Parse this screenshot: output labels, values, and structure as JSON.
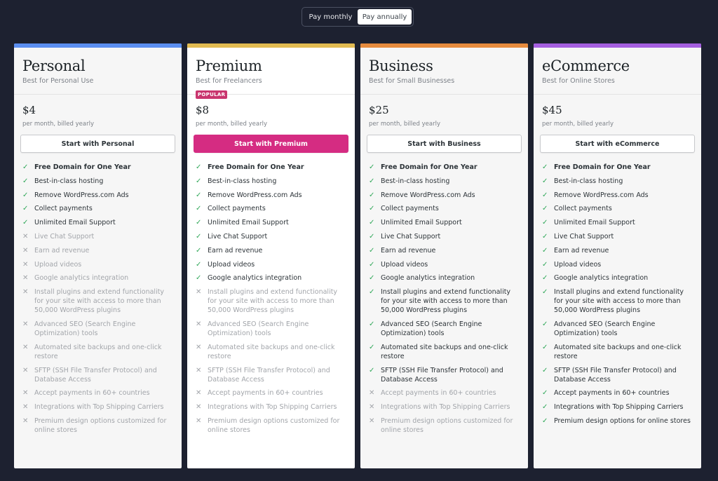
{
  "billing_toggle": {
    "options": [
      {
        "label": "Pay monthly",
        "active": false
      },
      {
        "label": "Pay annually",
        "active": true
      }
    ]
  },
  "icons": {
    "included": "✓",
    "excluded": "✕"
  },
  "plans": [
    {
      "name": "Personal",
      "tagline": "Best for Personal Use",
      "accent": "#5b8ef0",
      "badge": "",
      "price": "$4",
      "price_note": "per month, billed yearly",
      "cta": "Start with Personal",
      "cta_style": "secondary",
      "featured": false,
      "features": [
        {
          "text": "Free Domain for One Year",
          "included": true,
          "bold": true
        },
        {
          "text": "Best-in-class hosting",
          "included": true
        },
        {
          "text": "Remove WordPress.com Ads",
          "included": true
        },
        {
          "text": "Collect payments",
          "included": true
        },
        {
          "text": "Unlimited Email Support",
          "included": true
        },
        {
          "text": "Live Chat Support",
          "included": false
        },
        {
          "text": "Earn ad revenue",
          "included": false
        },
        {
          "text": "Upload videos",
          "included": false
        },
        {
          "text": "Google analytics integration",
          "included": false
        },
        {
          "text": "Install plugins and extend functionality for your site with access to more than 50,000 WordPress plugins",
          "included": false
        },
        {
          "text": "Advanced SEO (Search Engine Optimization) tools",
          "included": false
        },
        {
          "text": "Automated site backups and one-click restore",
          "included": false
        },
        {
          "text": "SFTP (SSH File Transfer Protocol) and Database Access",
          "included": false
        },
        {
          "text": "Accept payments in 60+ countries",
          "included": false
        },
        {
          "text": "Integrations with Top Shipping Carriers",
          "included": false
        },
        {
          "text": "Premium design options customized for online stores",
          "included": false
        }
      ]
    },
    {
      "name": "Premium",
      "tagline": "Best for Freelancers",
      "accent": "#e2bb51",
      "badge": "POPULAR",
      "price": "$8",
      "price_note": "per month, billed yearly",
      "cta": "Start with Premium",
      "cta_style": "primary",
      "featured": true,
      "features": [
        {
          "text": "Free Domain for One Year",
          "included": true,
          "bold": true
        },
        {
          "text": "Best-in-class hosting",
          "included": true
        },
        {
          "text": "Remove WordPress.com Ads",
          "included": true
        },
        {
          "text": "Collect payments",
          "included": true
        },
        {
          "text": "Unlimited Email Support",
          "included": true
        },
        {
          "text": "Live Chat Support",
          "included": true
        },
        {
          "text": "Earn ad revenue",
          "included": true
        },
        {
          "text": "Upload videos",
          "included": true
        },
        {
          "text": "Google analytics integration",
          "included": true
        },
        {
          "text": "Install plugins and extend functionality for your site with access to more than 50,000 WordPress plugins",
          "included": false
        },
        {
          "text": "Advanced SEO (Search Engine Optimization) tools",
          "included": false
        },
        {
          "text": "Automated site backups and one-click restore",
          "included": false
        },
        {
          "text": "SFTP (SSH File Transfer Protocol) and Database Access",
          "included": false
        },
        {
          "text": "Accept payments in 60+ countries",
          "included": false
        },
        {
          "text": "Integrations with Top Shipping Carriers",
          "included": false
        },
        {
          "text": "Premium design options customized for online stores",
          "included": false
        }
      ]
    },
    {
      "name": "Business",
      "tagline": "Best for Small Businesses",
      "accent": "#e68b3e",
      "badge": "",
      "price": "$25",
      "price_note": "per month, billed yearly",
      "cta": "Start with Business",
      "cta_style": "secondary",
      "featured": false,
      "features": [
        {
          "text": "Free Domain for One Year",
          "included": true,
          "bold": true
        },
        {
          "text": "Best-in-class hosting",
          "included": true
        },
        {
          "text": "Remove WordPress.com Ads",
          "included": true
        },
        {
          "text": "Collect payments",
          "included": true
        },
        {
          "text": "Unlimited Email Support",
          "included": true
        },
        {
          "text": "Live Chat Support",
          "included": true
        },
        {
          "text": "Earn ad revenue",
          "included": true
        },
        {
          "text": "Upload videos",
          "included": true
        },
        {
          "text": "Google analytics integration",
          "included": true
        },
        {
          "text": "Install plugins and extend functionality for your site with access to more than 50,000 WordPress plugins",
          "included": true
        },
        {
          "text": "Advanced SEO (Search Engine Optimization) tools",
          "included": true
        },
        {
          "text": "Automated site backups and one-click restore",
          "included": true
        },
        {
          "text": "SFTP (SSH File Transfer Protocol) and Database Access",
          "included": true
        },
        {
          "text": "Accept payments in 60+ countries",
          "included": false
        },
        {
          "text": "Integrations with Top Shipping Carriers",
          "included": false
        },
        {
          "text": "Premium design options customized for online stores",
          "included": false
        }
      ]
    },
    {
      "name": "eCommerce",
      "tagline": "Best for Online Stores",
      "accent": "#a55fe0",
      "badge": "",
      "price": "$45",
      "price_note": "per month, billed yearly",
      "cta": "Start with eCommerce",
      "cta_style": "secondary",
      "featured": false,
      "features": [
        {
          "text": "Free Domain for One Year",
          "included": true,
          "bold": true
        },
        {
          "text": "Best-in-class hosting",
          "included": true
        },
        {
          "text": "Remove WordPress.com Ads",
          "included": true
        },
        {
          "text": "Collect payments",
          "included": true
        },
        {
          "text": "Unlimited Email Support",
          "included": true
        },
        {
          "text": "Live Chat Support",
          "included": true
        },
        {
          "text": "Earn ad revenue",
          "included": true
        },
        {
          "text": "Upload videos",
          "included": true
        },
        {
          "text": "Google analytics integration",
          "included": true
        },
        {
          "text": "Install plugins and extend functionality for your site with access to more than 50,000 WordPress plugins",
          "included": true
        },
        {
          "text": "Advanced SEO (Search Engine Optimization) tools",
          "included": true
        },
        {
          "text": "Automated site backups and one-click restore",
          "included": true
        },
        {
          "text": "SFTP (SSH File Transfer Protocol) and Database Access",
          "included": true
        },
        {
          "text": "Accept payments in 60+ countries",
          "included": true
        },
        {
          "text": "Integrations with Top Shipping Carriers",
          "included": true
        },
        {
          "text": "Premium design options for online stores",
          "included": true
        }
      ]
    }
  ]
}
